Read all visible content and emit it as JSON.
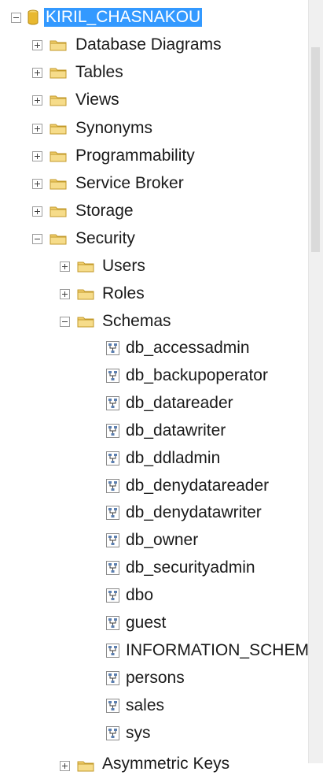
{
  "tree": {
    "database": {
      "label": "KIRIL_CHASNAKOU",
      "expanded": true,
      "selected": true
    },
    "top_folders": [
      {
        "label": "Database Diagrams"
      },
      {
        "label": "Tables"
      },
      {
        "label": "Views"
      },
      {
        "label": "Synonyms"
      },
      {
        "label": "Programmability"
      },
      {
        "label": "Service Broker"
      },
      {
        "label": "Storage"
      },
      {
        "label": "Security"
      }
    ],
    "security_children": [
      {
        "label": "Users"
      },
      {
        "label": "Roles"
      },
      {
        "label": "Schemas"
      }
    ],
    "schemas": [
      {
        "label": "db_accessadmin"
      },
      {
        "label": "db_backupoperator"
      },
      {
        "label": "db_datareader"
      },
      {
        "label": "db_datawriter"
      },
      {
        "label": "db_ddladmin"
      },
      {
        "label": "db_denydatareader"
      },
      {
        "label": "db_denydatawriter"
      },
      {
        "label": "db_owner"
      },
      {
        "label": "db_securityadmin"
      },
      {
        "label": "dbo"
      },
      {
        "label": "guest"
      },
      {
        "label": "INFORMATION_SCHEM"
      },
      {
        "label": "persons"
      },
      {
        "label": "sales"
      },
      {
        "label": "sys"
      }
    ],
    "partial_next": {
      "label": "Asymmetric Keys"
    }
  },
  "colors": {
    "selection": "#3399ff",
    "folder": "#e8c15a",
    "database": "#e8b830"
  },
  "icons": {
    "expand": "plus-box-icon",
    "collapse": "minus-box-icon",
    "folder": "folder-icon",
    "schema": "schema-icon",
    "database": "database-icon"
  }
}
